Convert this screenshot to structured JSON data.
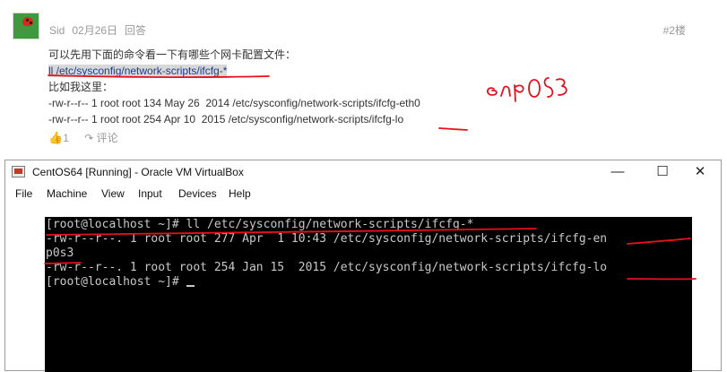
{
  "post": {
    "author": "Sid",
    "date": "02月26日",
    "reply_label": "回答",
    "floor": "#2楼",
    "intro": "可以先用下面的命令看一下有哪些个网卡配置文件：",
    "command": "ll /etc/sysconfig/network-scripts/ifcfg-*",
    "example_label": "比如我这里：",
    "lines": [
      "-rw-r--r-- 1 root root 134 May 26  2014 /etc/sysconfig/network-scripts/ifcfg-eth0",
      "-rw-r--r-- 1 root root 254 Apr 10  2015 /etc/sysconfig/network-scripts/ifcfg-lo"
    ],
    "likes": "1",
    "comment_label": "评论",
    "handwritten_note": "enp0s3"
  },
  "window": {
    "title": "CentOS64 [Running] - Oracle VM VirtualBox",
    "menu": [
      "File",
      "Machine",
      "View",
      "Input",
      "Devices",
      "Help"
    ],
    "terminal": [
      "[root@localhost ~]# ll /etc/sysconfig/network-scripts/ifcfg-*",
      "-rw-r--r--. 1 root root 277 Apr  1 10:43 /etc/sysconfig/network-scripts/ifcfg-en",
      "p0s3",
      "-rw-r--r--. 1 root root 254 Jan 15  2015 /etc/sysconfig/network-scripts/ifcfg-lo",
      "[root@localhost ~]# "
    ]
  },
  "colors": {
    "annotation": "#e8101a",
    "console_bg": "#000000",
    "console_text": "#c8c8c8",
    "like": "#4caf50"
  },
  "icons": {
    "like": "thumbs-up-icon",
    "comment": "reply-arrow-icon",
    "window": "virtualbox-app-icon"
  }
}
